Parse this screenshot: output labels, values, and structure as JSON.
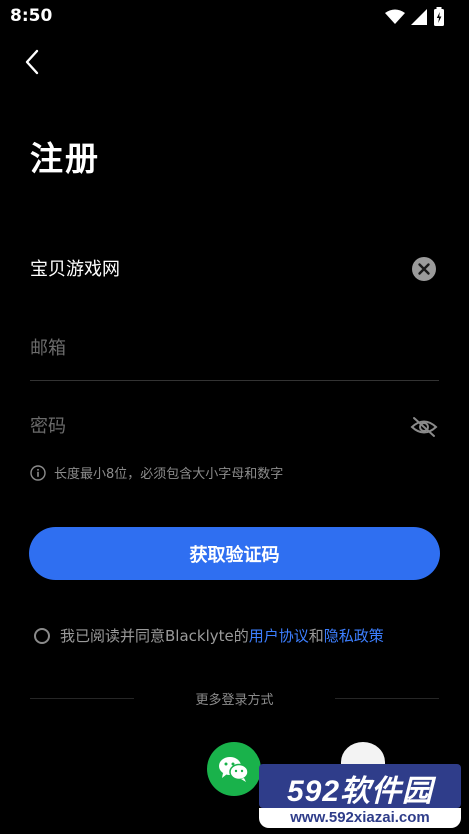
{
  "status_bar": {
    "time": "8:50",
    "icons": [
      "wifi-icon",
      "signal-icon",
      "battery-icon"
    ]
  },
  "header": {
    "back_icon": "chevron-left-icon",
    "title": "注册"
  },
  "form": {
    "username": {
      "value": "宝贝游戏网",
      "clear_icon": "clear-icon"
    },
    "email": {
      "value": "",
      "placeholder": "邮箱"
    },
    "password": {
      "value": "",
      "placeholder": "密码",
      "toggle_icon": "eye-off-icon"
    },
    "hint": {
      "icon": "info-icon",
      "text": "长度最小8位，必须包含大小字母和数字"
    }
  },
  "primary_action": {
    "label": "获取验证码"
  },
  "agreement": {
    "checked": false,
    "prefix": "我已阅读并同意Blacklyte的",
    "terms_link": "用户协议",
    "connector": "和",
    "privacy_link": "隐私政策"
  },
  "alt_login": {
    "label": "更多登录方式",
    "wechat_icon": "wechat-icon"
  },
  "watermark": {
    "brand": "592软件园",
    "url": "www.592xiazai.com"
  },
  "colors": {
    "background": "#000000",
    "accent": "#2f6ff1",
    "link": "#3d7fff",
    "wechat": "#19b24b",
    "muted_text": "#8c8c8c"
  }
}
